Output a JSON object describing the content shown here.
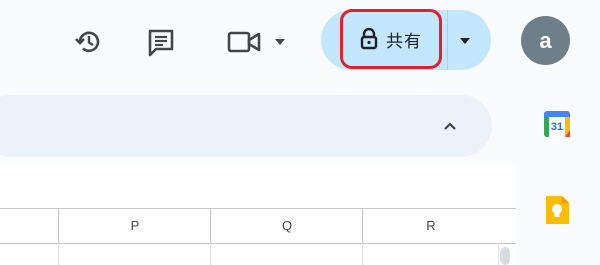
{
  "toolbar": {
    "history_icon": "history-icon",
    "comment_icon": "comment-icon",
    "meet_icon": "video-camera-icon",
    "share_label": "共有",
    "share_icon": "lock-icon",
    "share_dropdown_icon": "caret-down-icon"
  },
  "account": {
    "avatar_letter": "a"
  },
  "sheet": {
    "columns": [
      "P",
      "Q",
      "R"
    ]
  },
  "side_panel": {
    "calendar_day": "31",
    "calendar_icon": "calendar-icon",
    "keep_icon": "keep-icon"
  },
  "colors": {
    "share_bg": "#c2e7ff",
    "highlight": "#e0202a",
    "avatar_bg": "#6e7f8a"
  }
}
